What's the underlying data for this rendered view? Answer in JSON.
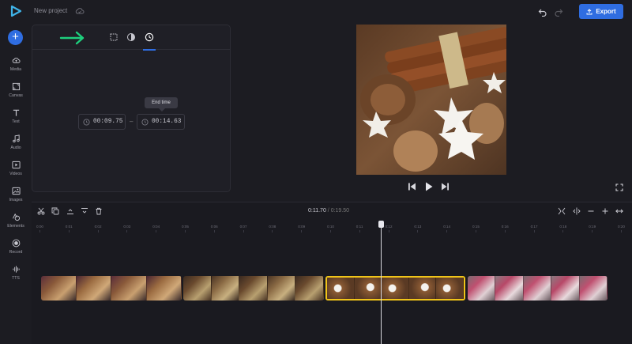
{
  "header": {
    "project_name": "New project",
    "export_label": "Export",
    "accent_color": "#2f6de1"
  },
  "sidebar": {
    "items": [
      {
        "label": "Media",
        "icon": "cloud-upload-icon"
      },
      {
        "label": "Canvas",
        "icon": "canvas-icon"
      },
      {
        "label": "Text",
        "icon": "text-icon"
      },
      {
        "label": "Audio",
        "icon": "music-note-icon"
      },
      {
        "label": "Videos",
        "icon": "video-icon"
      },
      {
        "label": "Images",
        "icon": "image-icon"
      },
      {
        "label": "Elements",
        "icon": "shapes-icon"
      },
      {
        "label": "Record",
        "icon": "record-icon"
      },
      {
        "label": "TTS",
        "icon": "tts-icon"
      }
    ]
  },
  "panel": {
    "tabs": [
      "crop-icon",
      "filter-icon",
      "clock-icon"
    ],
    "active_tab": "clock-icon",
    "start_time": "00:09.75",
    "end_time": "00:14.63",
    "tooltip": "End time",
    "separator": "–"
  },
  "timeline": {
    "current_time": "0:11.70",
    "separator": "/",
    "total_time": "0:19.50",
    "ruler": [
      "0:00",
      "0:01",
      "0:02",
      "0:03",
      "0:04",
      "0:05",
      "0:06",
      "0:07",
      "0:08",
      "0:09",
      "0:10",
      "0:11",
      "0:12",
      "0:13",
      "0:14",
      "0:15",
      "0:16",
      "0:17",
      "0:18",
      "0:19",
      "0:20"
    ],
    "selected_clip_color": "#f0c419"
  }
}
